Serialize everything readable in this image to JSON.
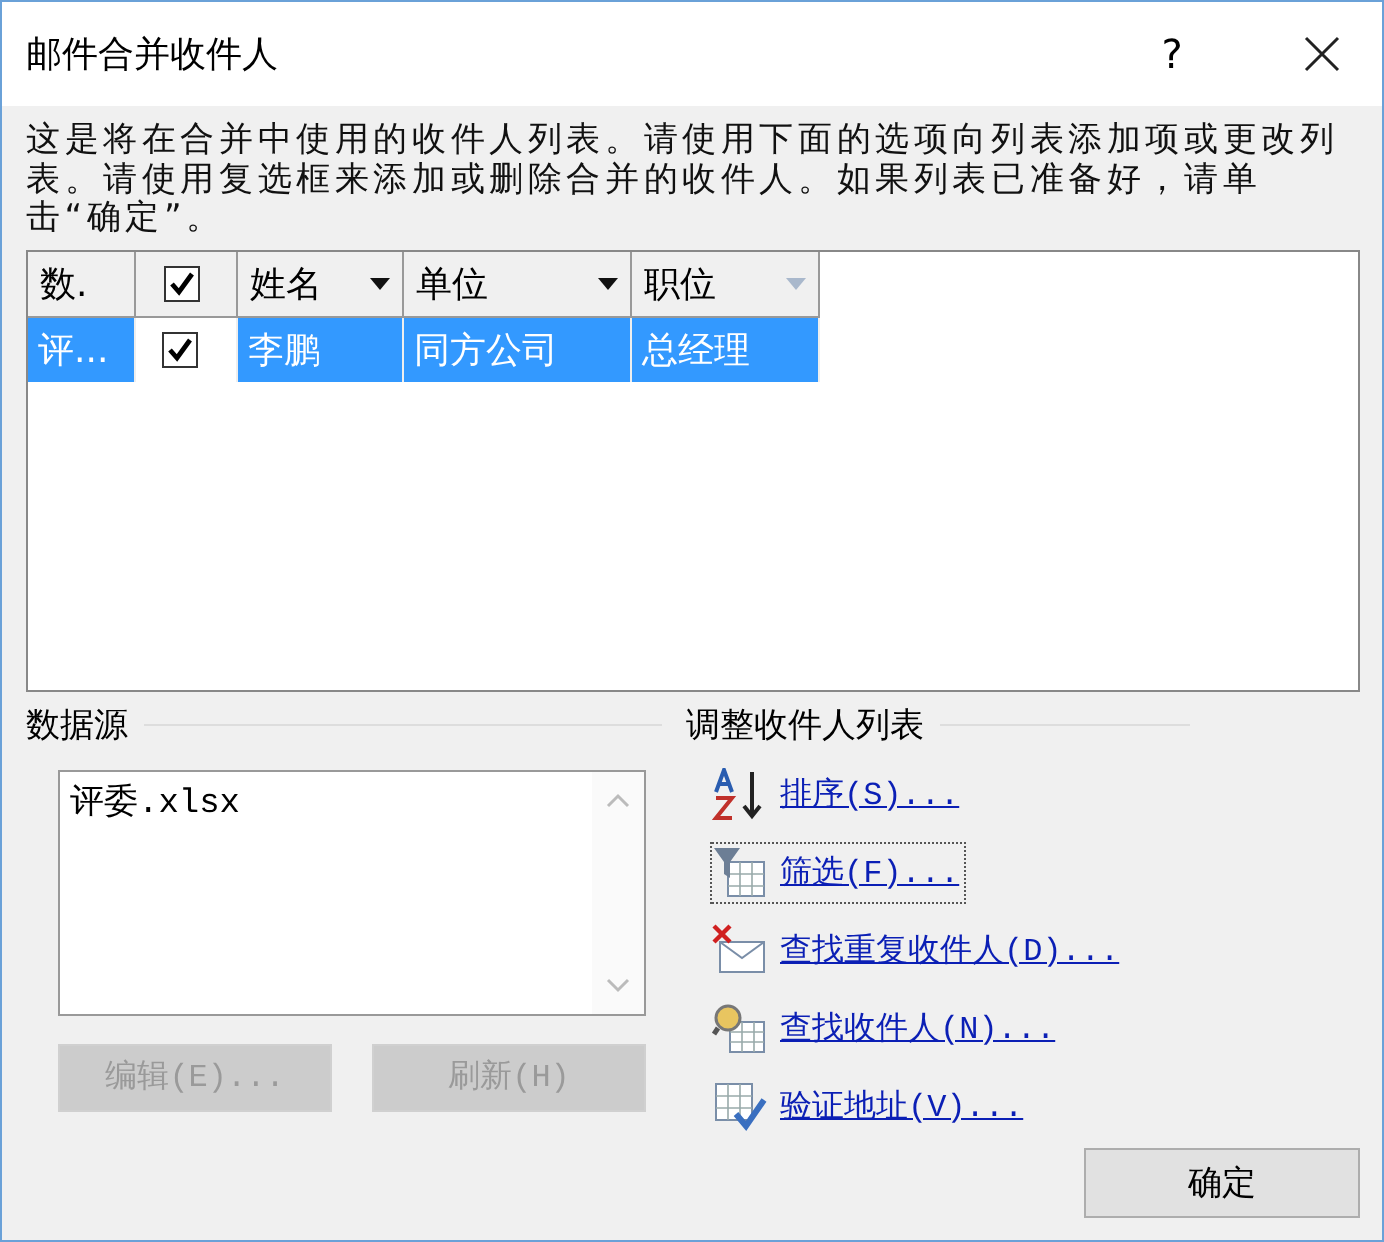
{
  "window": {
    "title": "邮件合并收件人",
    "help": "?"
  },
  "description": "这是将在合并中使用的收件人列表。请使用下面的选项向列表添加项或更改列表。请使用复选框来添加或删除合并的收件人。如果列表已准备好，请单击“确定”。",
  "table": {
    "columns": [
      {
        "kind": "text",
        "label": "数."
      },
      {
        "kind": "checkbox",
        "checked": true
      },
      {
        "kind": "text",
        "label": "姓名",
        "dropdown": true,
        "dimmed": false
      },
      {
        "kind": "text",
        "label": "单位",
        "dropdown": true,
        "dimmed": false
      },
      {
        "kind": "text",
        "label": "职位",
        "dropdown": true,
        "dimmed": true
      }
    ],
    "rows": [
      {
        "selected": true,
        "checked": true,
        "cells": [
          "评...",
          "",
          "李鹏",
          "同方公司",
          "总经理"
        ]
      }
    ]
  },
  "data_source": {
    "label": "数据源",
    "items": [
      "评委.xlsx"
    ],
    "buttons": [
      {
        "label": "编辑(E)...",
        "disabled": true
      },
      {
        "label": "刷新(H)",
        "disabled": true
      }
    ]
  },
  "adjust": {
    "label": "调整收件人列表",
    "links": [
      {
        "kind": "sort",
        "label": "排序(S)...",
        "focused": false
      },
      {
        "kind": "filter",
        "label": "筛选(F)...",
        "focused": true
      },
      {
        "kind": "duplicates",
        "label": "查找重复收件人(D)...",
        "focused": false
      },
      {
        "kind": "find",
        "label": "查找收件人(N)...",
        "focused": false
      },
      {
        "kind": "validate",
        "label": "验证地址(V)...",
        "focused": false
      }
    ]
  },
  "ok_button": "确定"
}
